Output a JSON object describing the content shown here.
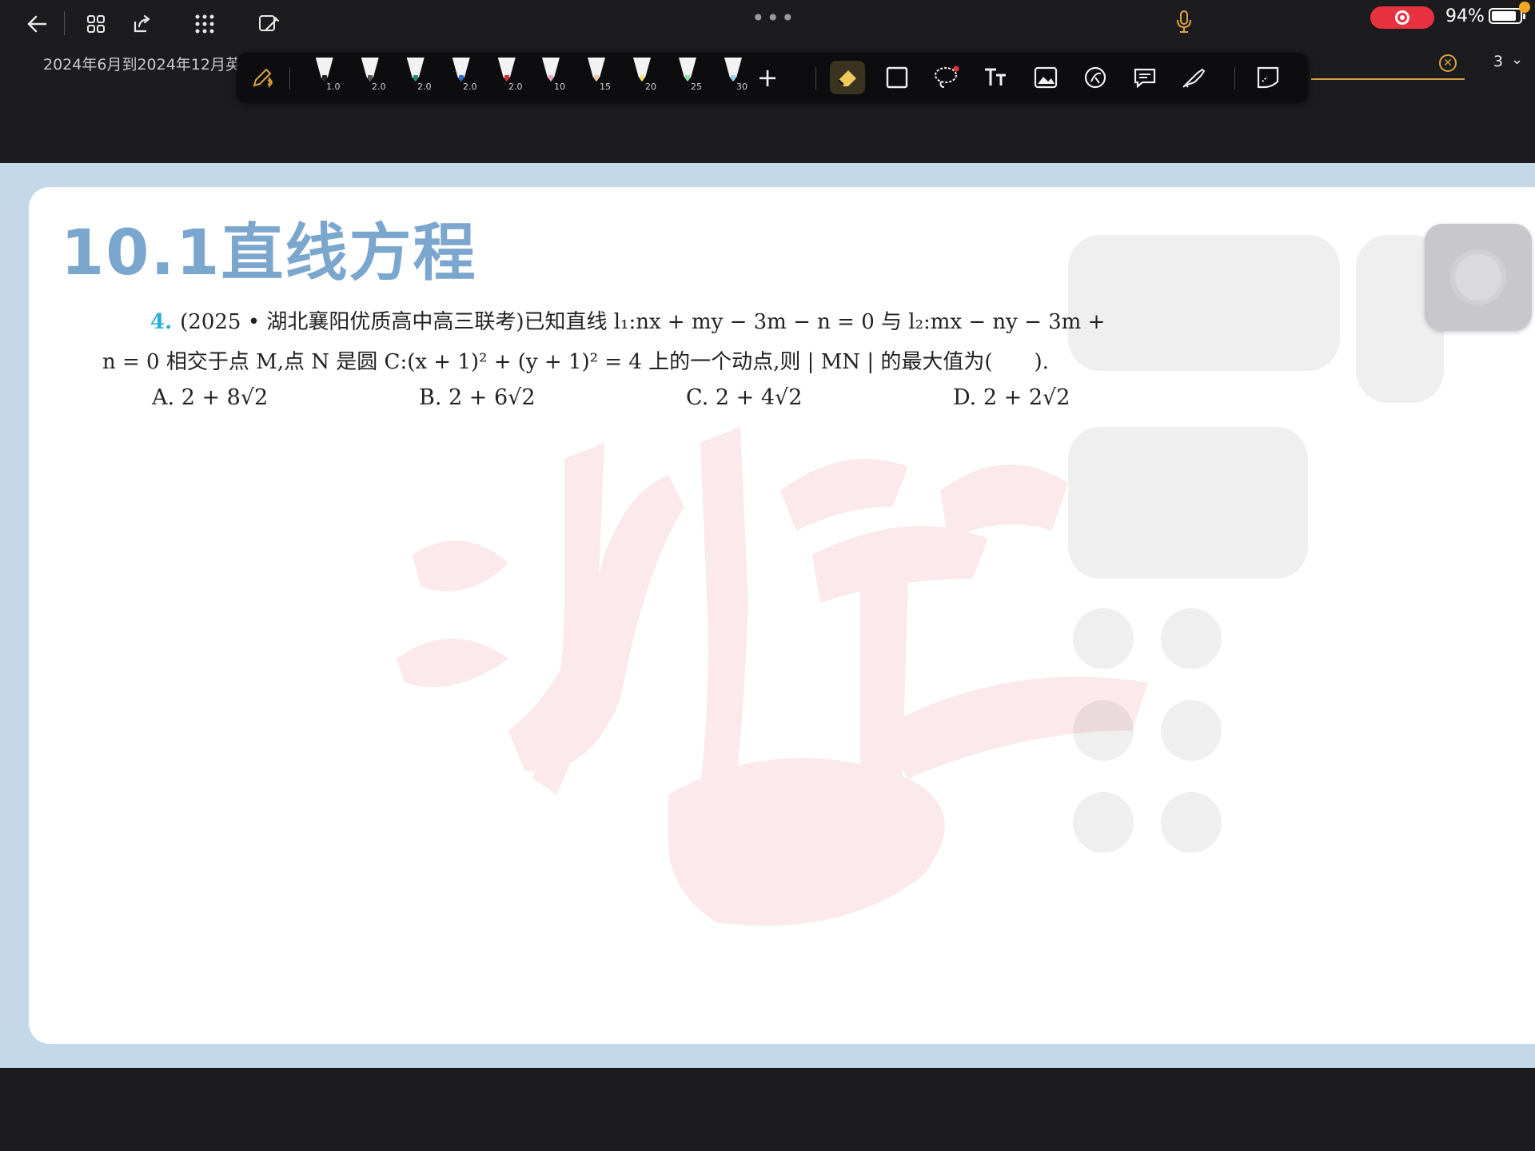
{
  "topbar": {
    "doc_title": "2024年6月到2024年12月英",
    "battery_percent": "94%",
    "page_number": "3",
    "more_dots": "•••"
  },
  "pen_toolbar": {
    "pens": [
      {
        "size": "1.0",
        "color": "#f2f2f2",
        "tip": "#222222"
      },
      {
        "size": "2.0",
        "color": "#f2f2f2",
        "tip": "#555555"
      },
      {
        "size": "2.0",
        "color": "#f2f2f2",
        "tip": "#1e8f6b"
      },
      {
        "size": "2.0",
        "color": "#f2f2f2",
        "tip": "#2a6fd6"
      },
      {
        "size": "2.0",
        "color": "#f2f2f2",
        "tip": "#d62b3a"
      },
      {
        "size": "10",
        "color": "#f2f2f2",
        "tip": "#f2a3c8"
      },
      {
        "size": "15",
        "color": "#f2f2f2",
        "tip": "#f5c7a0"
      },
      {
        "size": "20",
        "color": "#f2f2f2",
        "tip": "#f5e27a"
      },
      {
        "size": "25",
        "color": "#f2f2f2",
        "tip": "#8be3a8"
      },
      {
        "size": "30",
        "color": "#f2f2f2",
        "tip": "#8fd6f2"
      }
    ],
    "add_label": "+"
  },
  "page": {
    "section_title": "10.1直线方程",
    "question": {
      "number": "4.",
      "line1": "(2025 • 湖北襄阳优质高中高三联考)已知直线 l₁:nx + my − 3m − n = 0 与 l₂:mx − ny − 3m +",
      "line2": "n = 0 相交于点 M,点 N 是圆 C:(x + 1)² + (y + 1)² = 4 上的一个动点,则 | MN | 的最大值为(　　)."
    },
    "choices": [
      {
        "label": "A.",
        "value": "2 + 8√2"
      },
      {
        "label": "B.",
        "value": "2 + 6√2"
      },
      {
        "label": "C.",
        "value": "2 + 4√2"
      },
      {
        "label": "D.",
        "value": "2 + 2√2"
      }
    ]
  },
  "colors": {
    "accent_gold": "#d9a441",
    "record_red": "#e8323f",
    "title_blue": "#7ba6cd",
    "question_number": "#2ab0d8"
  }
}
